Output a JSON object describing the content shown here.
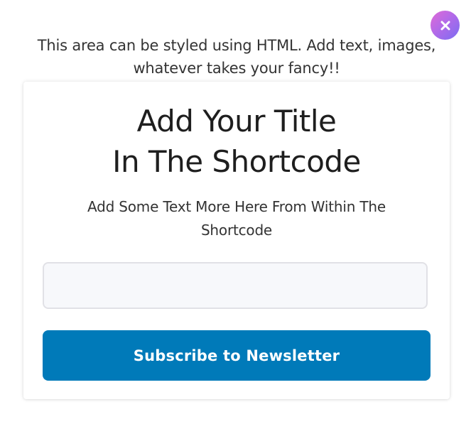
{
  "intro": {
    "text": "This area can be styled using HTML. Add text, images, whatever takes your fancy!!"
  },
  "close": {
    "icon": "close-icon"
  },
  "card": {
    "title_line1": "Add Your Title",
    "title_line2": "In The Shortcode",
    "subtitle": "Add Some Text More Here From Within The Shortcode",
    "input": {
      "value": "",
      "placeholder": ""
    },
    "button_label": "Subscribe to Newsletter"
  },
  "colors": {
    "button": "#007ab9",
    "close_gradient_start": "#e06ad6",
    "close_gradient_end": "#7a6cf2"
  }
}
